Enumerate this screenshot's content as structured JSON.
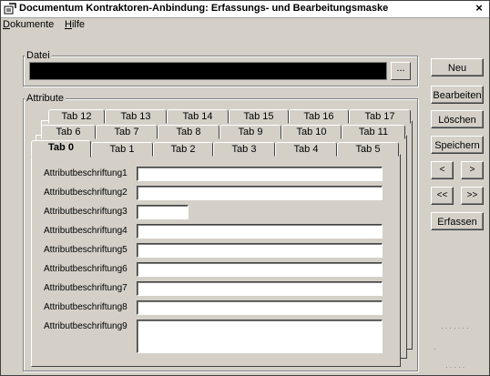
{
  "window": {
    "title": "Documentum Kontraktoren-Anbindung: Erfassungs- und Bearbeitungsmaske",
    "close_symbol": "×"
  },
  "menu": [
    "Dokumente",
    "Hilfe"
  ],
  "file_group": {
    "label": "Datei",
    "browse_label": "..."
  },
  "attr_group": {
    "label": "Attribute"
  },
  "tabs": {
    "row3": [
      "Tab 12",
      "Tab 13",
      "Tab 14",
      "Tab 15",
      "Tab 16",
      "Tab 17"
    ],
    "row2": [
      "Tab 6",
      "Tab 7",
      "Tab 8",
      "Tab 9",
      "Tab 10",
      "Tab 11"
    ],
    "row1": [
      "Tab 0",
      "Tab 1",
      "Tab 2",
      "Tab 3",
      "Tab 4",
      "Tab 5"
    ],
    "active": "Tab 0"
  },
  "fields": [
    "Attributbeschriftung1",
    "Attributbeschriftung2",
    "Attributbeschriftung3",
    "Attributbeschriftung4",
    "Attributbeschriftung5",
    "Attributbeschriftung6",
    "Attributbeschriftung7",
    "Attributbeschriftung8",
    "Attributbeschriftung9"
  ],
  "buttons": {
    "neu": "Neu",
    "bearbeiten": "Bearbeiten",
    "loeschen": "Löschen",
    "speichern": "Speichern",
    "prev": "<",
    "next": ">",
    "first": "<<",
    "last": ">>",
    "erfassen": "Erfassen"
  },
  "icons": {
    "app": "app-icon",
    "close": "close-icon"
  }
}
